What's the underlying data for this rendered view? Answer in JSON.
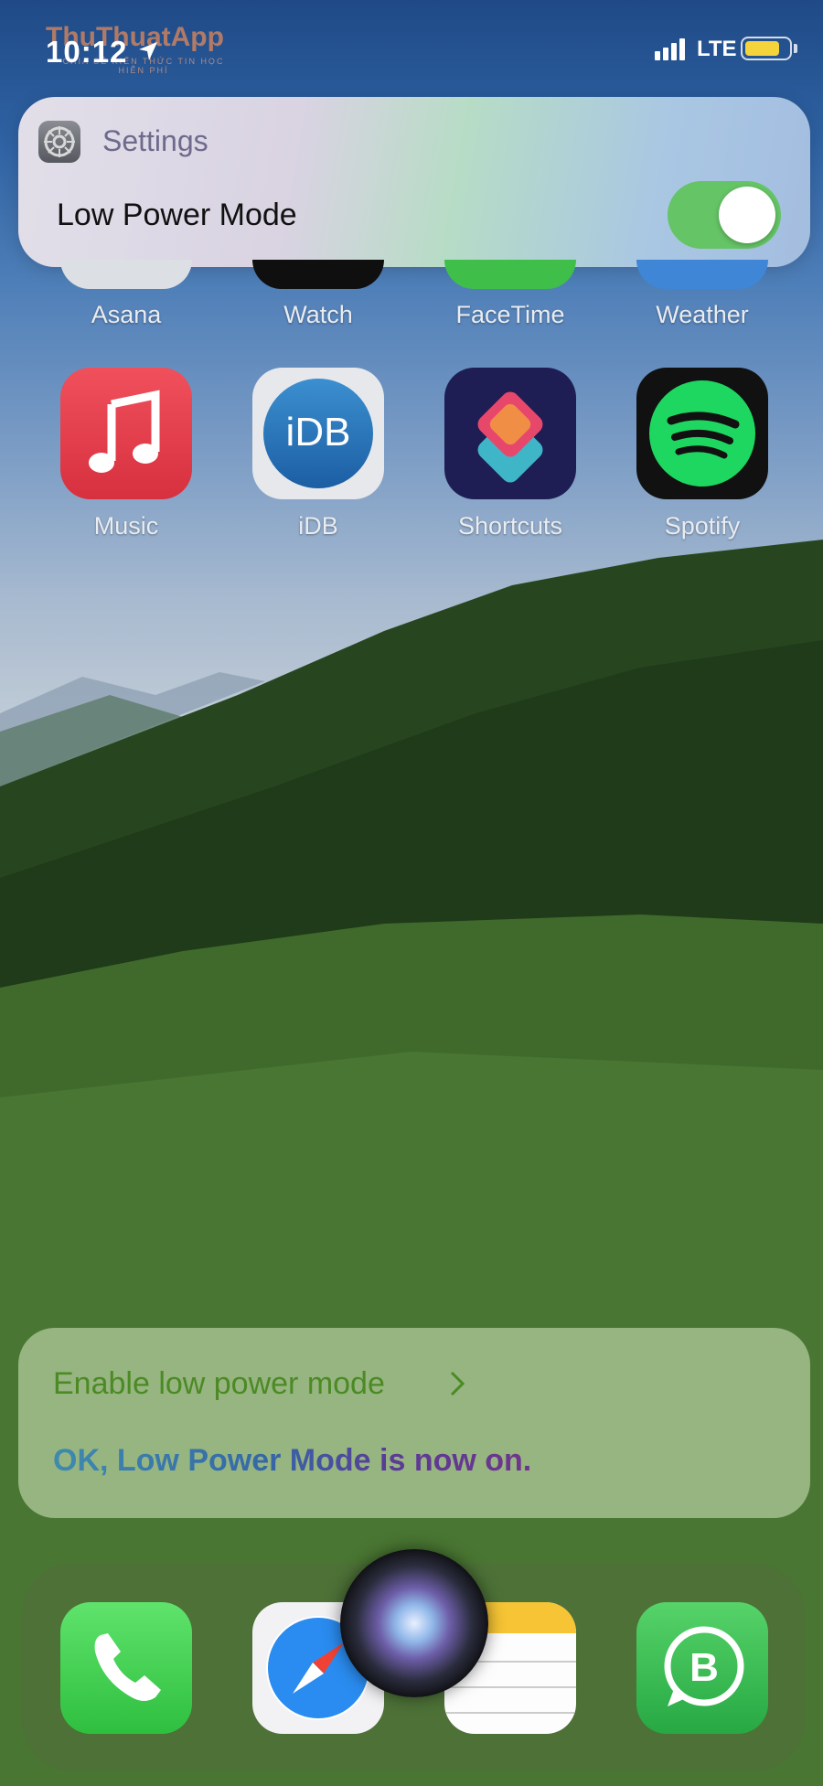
{
  "status_bar": {
    "time": "10:12",
    "watermark": "ThuThuatApp",
    "watermark_sub": "CHIA SẺ KIẾN THỨC TIN HỌC HIỄN PHÍ",
    "network": "LTE",
    "battery_color": "#f5d33a",
    "battery_level": 0.8
  },
  "banner": {
    "app_name": "Settings",
    "setting_label": "Low Power Mode",
    "toggle_on": true,
    "toggle_color": "#65c466"
  },
  "apps_partial_row": [
    {
      "label": "Asana",
      "icon": "asana-icon"
    },
    {
      "label": "Watch",
      "icon": "watch-icon"
    },
    {
      "label": "FaceTime",
      "icon": "facetime-icon"
    },
    {
      "label": "Weather",
      "icon": "weather-icon"
    }
  ],
  "apps_row": [
    {
      "label": "Music",
      "icon": "music-icon"
    },
    {
      "label": "iDB",
      "icon": "idb-icon",
      "icon_text": "iDB"
    },
    {
      "label": "Shortcuts",
      "icon": "shortcuts-icon"
    },
    {
      "label": "Spotify",
      "icon": "spotify-icon"
    }
  ],
  "siri": {
    "request": "Enable low power mode",
    "response": "OK, Low Power Mode is now on."
  },
  "dock": [
    {
      "icon": "phone-icon"
    },
    {
      "icon": "safari-icon"
    },
    {
      "icon": "notes-icon"
    },
    {
      "icon": "whatsapp-business-icon"
    }
  ]
}
